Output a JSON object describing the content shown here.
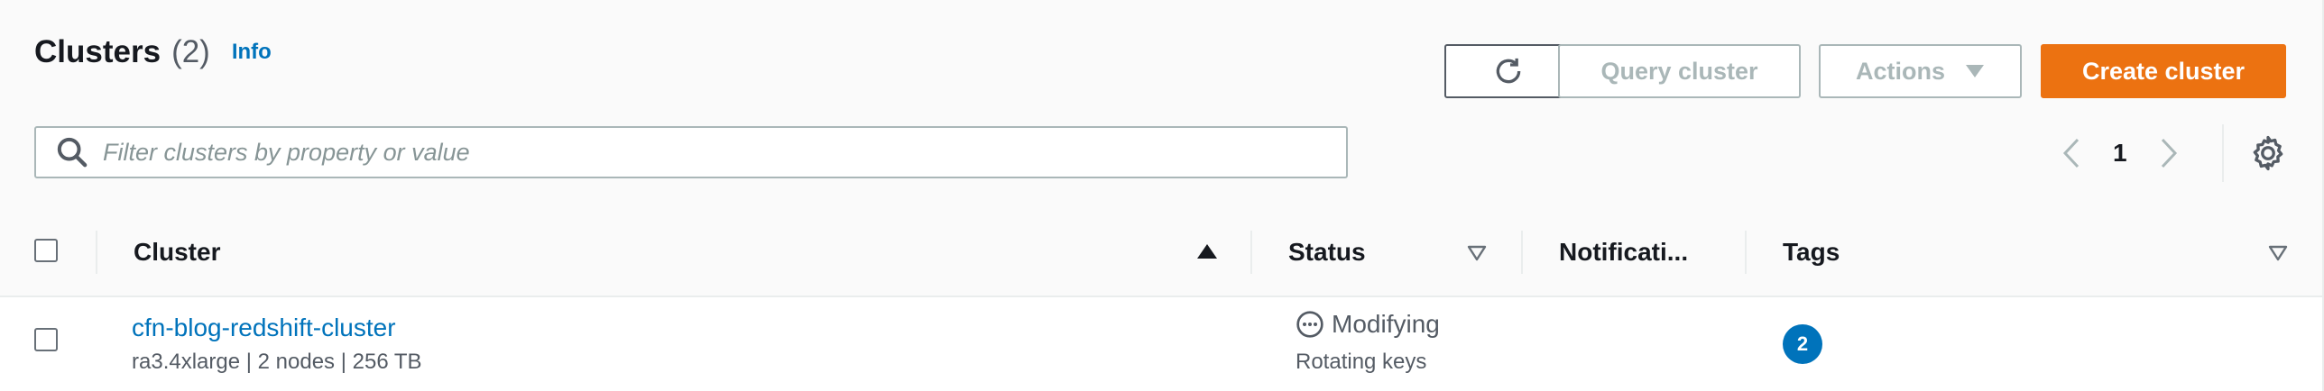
{
  "header": {
    "title": "Clusters",
    "count": "(2)",
    "info_label": "Info"
  },
  "toolbar": {
    "refresh_icon": "refresh-icon",
    "query_label": "Query cluster",
    "actions_label": "Actions",
    "create_label": "Create cluster"
  },
  "search": {
    "placeholder": "Filter clusters by property or value",
    "value": ""
  },
  "pagination": {
    "current_page": "1"
  },
  "table": {
    "columns": [
      {
        "label": "Cluster",
        "sort": "ascending"
      },
      {
        "label": "Status",
        "sort": "sortable"
      },
      {
        "label": "Notificati...",
        "sort": "none"
      },
      {
        "label": "Tags",
        "sort": "sortable"
      }
    ],
    "rows": [
      {
        "cluster_name": "cfn-blog-redshift-cluster",
        "cluster_meta": "ra3.4xlarge | 2 nodes | 256 TB",
        "status": "Modifying",
        "status_detail": "Rotating keys",
        "notifications": "",
        "tags_count": "2"
      }
    ]
  },
  "colors": {
    "link": "#0073bb",
    "primary_button": "#ec7211",
    "disabled_text": "#aab7b8",
    "badge": "#0073bb"
  }
}
